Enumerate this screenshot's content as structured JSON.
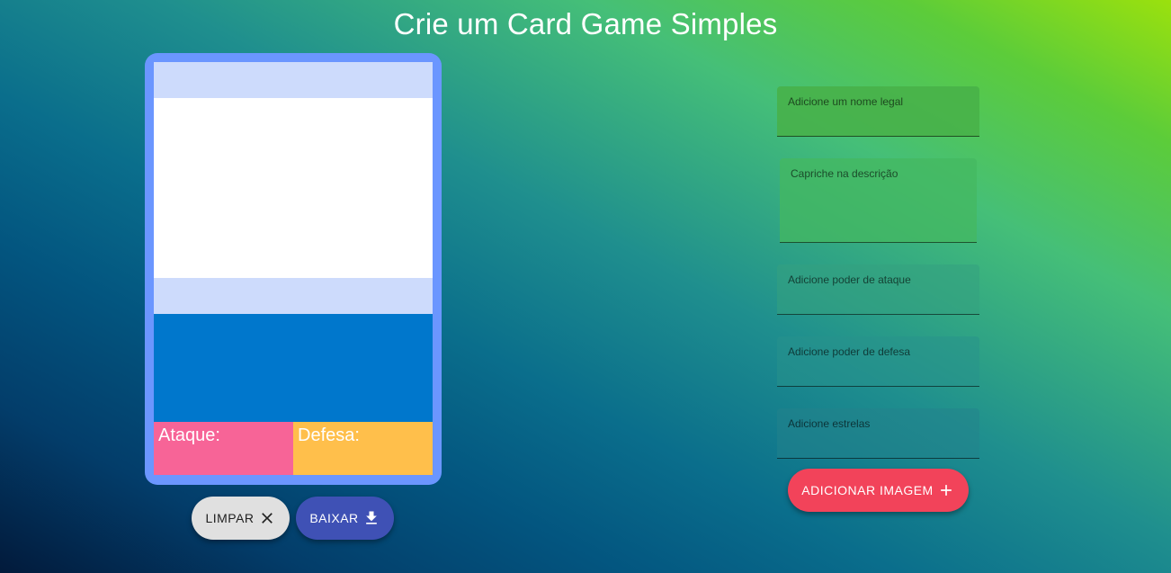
{
  "page": {
    "title": "Crie um Card Game Simples"
  },
  "card": {
    "attack_label": "Ataque:",
    "defense_label": "Defesa:",
    "colors": {
      "border": "#6b96ff",
      "band": "#cddbfc",
      "description": "#0077cc",
      "attack": "#f76497",
      "defense": "#ffbf4b"
    }
  },
  "actions": {
    "clear_label": "LIMPAR",
    "clear_icon": "close-icon",
    "download_label": "BAIXAR",
    "download_icon": "download-icon",
    "add_image_label": "ADICIONAR IMAGEM",
    "add_image_icon": "plus-icon"
  },
  "form": {
    "name_label": "Adicione um nome legal",
    "name_value": "",
    "description_label": "Capriche na descrição",
    "description_value": "",
    "attack_label": "Adicione poder de ataque",
    "attack_value": "",
    "defense_label": "Adicione poder de defesa",
    "defense_value": "",
    "stars_label": "Adicione estrelas",
    "stars_value": ""
  }
}
